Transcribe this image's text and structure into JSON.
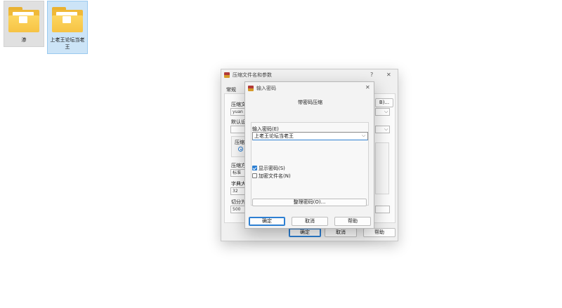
{
  "desktop": {
    "icons": [
      {
        "label": "渗"
      },
      {
        "label": "上老王论坛当老王"
      }
    ]
  },
  "archive_dialog": {
    "title": "压缩文件名和参数",
    "help_glyph": "?",
    "close_glyph": "✕",
    "tab_general": "常规",
    "archive_name_label": "压缩文",
    "archive_name_value": "yuan",
    "browse_label": "B)...",
    "profile_label": "默认设",
    "format_label": "压缩",
    "method_label": "压缩方",
    "method_value": "标准",
    "dict_label": "字典大",
    "dict_value": "32",
    "split_label": "切分为",
    "split_value": "500",
    "ok_label": "确定",
    "cancel_label": "取消",
    "help_label": "帮助"
  },
  "password_dialog": {
    "title": "输入密码",
    "close_glyph": "✕",
    "heading": "带密码压缩",
    "input_label": "输入密码(E)",
    "password_value": "上老王论坛当老王",
    "show_password_label": "显示密码(S)",
    "show_password_checked": true,
    "encrypt_names_label": "加密文件名(N)",
    "encrypt_names_checked": false,
    "organize_label": "整理密码(O)...",
    "ok_label": "确定",
    "cancel_label": "取消",
    "help_label": "帮助"
  },
  "colors": {
    "accent": "#2d7fd2",
    "folder": "#f6c344"
  }
}
